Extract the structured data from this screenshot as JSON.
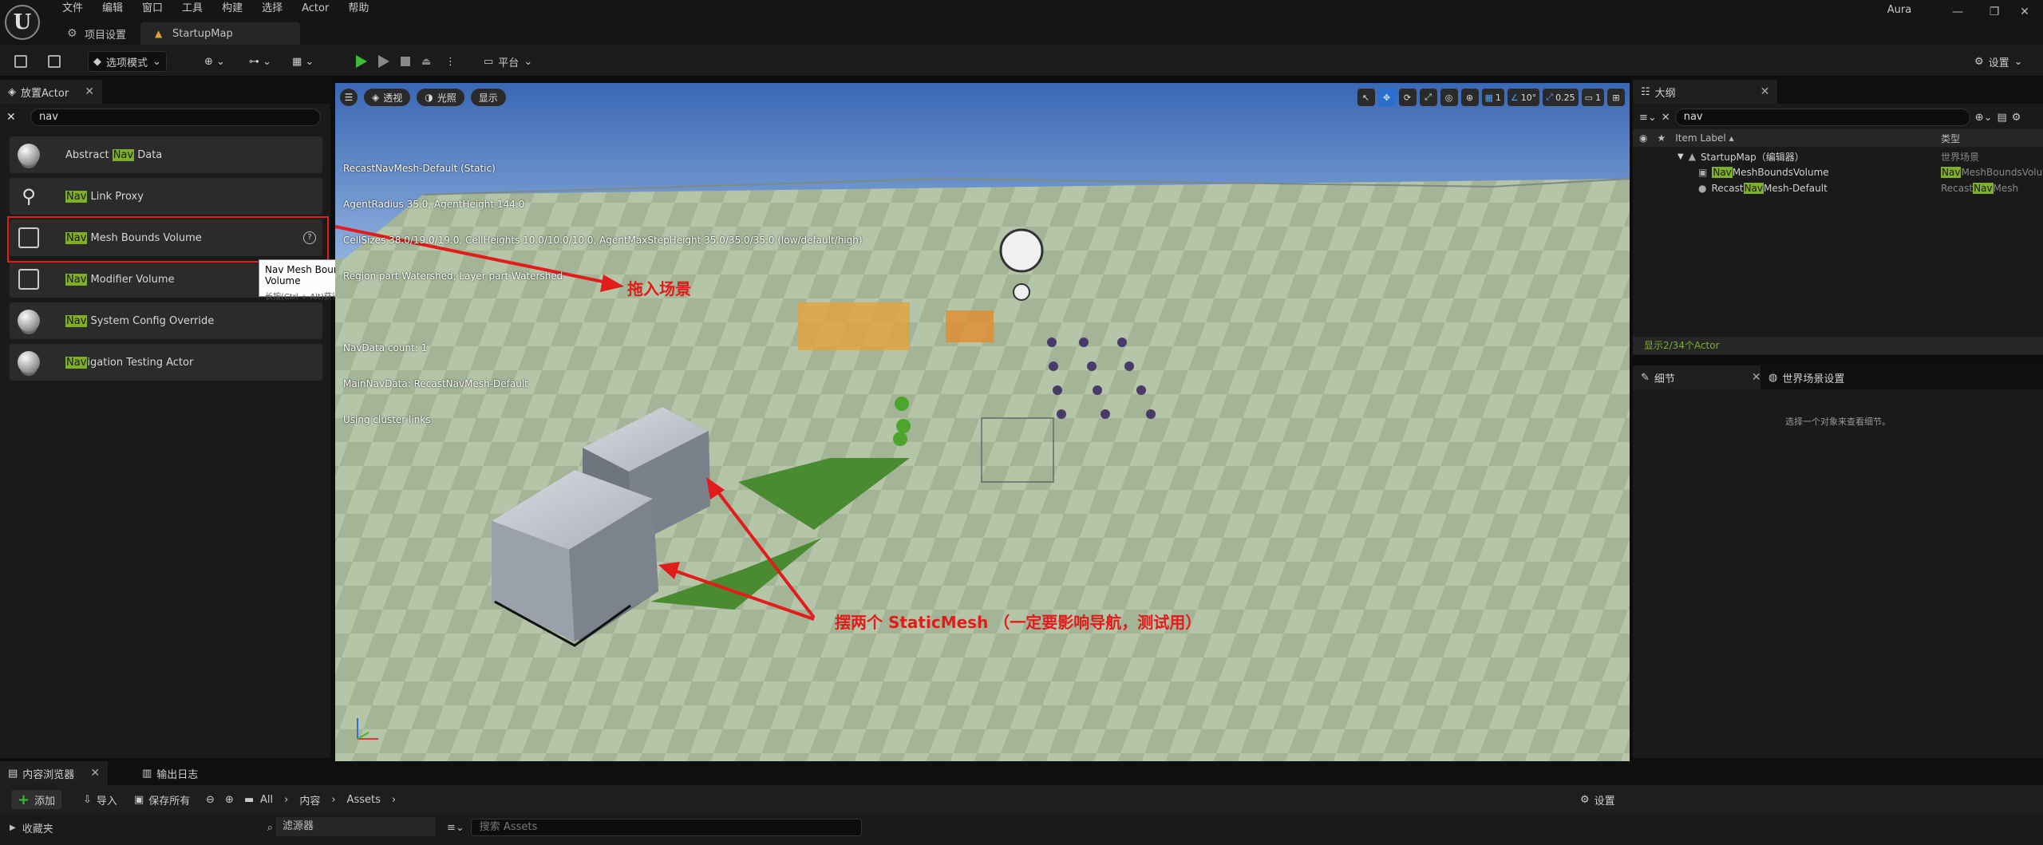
{
  "menu": [
    "文件",
    "编辑",
    "窗口",
    "工具",
    "构建",
    "选择",
    "Actor",
    "帮助"
  ],
  "tabs": {
    "project_settings": "项目设置",
    "map": "StartupMap"
  },
  "user": "Aura",
  "toolbar": {
    "mode": "选项模式",
    "platform": "平台",
    "settings": "设置"
  },
  "place_actors": {
    "tab_label": "放置Actor",
    "search_value": "nav",
    "items": [
      {
        "pre": "Abstract ",
        "hl": "Nav",
        "post": " Data"
      },
      {
        "pre": "",
        "hl": "Nav",
        "post": " Link Proxy"
      },
      {
        "pre": "",
        "hl": "Nav",
        "post": " Mesh Bounds Volume"
      },
      {
        "pre": "",
        "hl": "Nav",
        "post": " Modifier Volume"
      },
      {
        "pre": "",
        "hl": "Nav",
        "post": " System Config Override"
      },
      {
        "pre": "",
        "hl": "Nav",
        "post": "igation Testing Actor"
      }
    ],
    "tooltip_title": "Nav Mesh Bounds Volume",
    "tooltip_hint": "长按(Ctrl + Alt)获得更多信息"
  },
  "viewport": {
    "perspective": "透视",
    "lit": "光照",
    "show": "显示",
    "grid_value": "1",
    "angle_value": "10°",
    "scale_value": "0.25",
    "camera_speed": "1",
    "stats": [
      "RecastNavMesh-Default (Static)",
      "AgentRadius 35.0, AgentHeight 144.0",
      "CellSizes 38.0/19.0/19.0, CellHeights 10.0/10.0/10.0, AgentMaxStepHeight 35.0/35.0/35.0 (low/default/high)",
      "Region part Watershed, Layer part Watershed",
      "",
      "NavData count: 1",
      "MainNavData: RecastNavMesh-Default",
      "Using cluster links"
    ],
    "annotation_drag": "拖入场景",
    "annotation_meshes": "摆两个 StaticMesh （一定要影响导航，测试用）"
  },
  "outliner": {
    "tab_label": "大纲",
    "search_value": "nav",
    "col_label": "Item Label ▴",
    "col_type": "类型",
    "rows": [
      {
        "label": "StartupMap（编辑器）",
        "type": "世界场景"
      },
      {
        "label_hl": "Nav",
        "label_post": "MeshBoundsVolume",
        "type_hl": "Nav",
        "type_post": "MeshBoundsVolu"
      },
      {
        "label_pre": "Recast",
        "label_hl": "Nav",
        "label_post": "Mesh-Default",
        "type_pre": "Recast",
        "type_hl": "Nav",
        "type_post": "Mesh"
      }
    ],
    "footer": "显示2/34个Actor"
  },
  "details": {
    "tab_details": "细节",
    "tab_world": "世界场景设置",
    "empty_message": "选择一个对象来查看细节。"
  },
  "content_browser": {
    "tab_label": "内容浏览器",
    "tab_output": "输出日志",
    "add": "添加",
    "import": "导入",
    "save_all": "保存所有",
    "path": [
      "All",
      "内容",
      "Assets"
    ],
    "settings": "设置",
    "favorites": "收藏夹",
    "filters": "滤源器",
    "search_placeholder": "搜索 Assets"
  },
  "colors": {
    "highlight": "#7fae2c",
    "annotation": "#e21b1b",
    "accent": "#2a6fd0"
  }
}
